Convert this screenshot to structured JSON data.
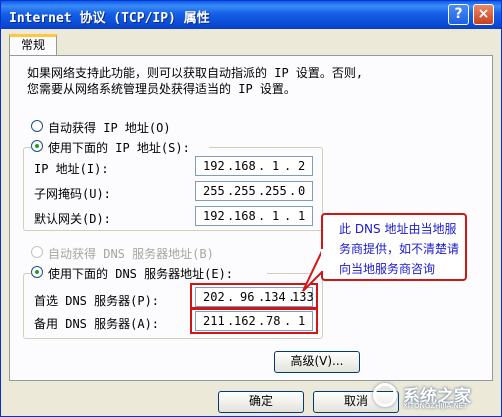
{
  "window": {
    "title": "Internet 协议 (TCP/IP) 属性",
    "help_glyph": "?",
    "close_glyph": "×"
  },
  "tab": {
    "label": "常规"
  },
  "description": {
    "line1": "如果网络支持此功能，则可以获取自动指派的 IP 设置。否则,",
    "line2": "您需要从网络系统管理员处获得适当的 IP 设置。"
  },
  "ip_section": {
    "auto_label": "自动获得 IP 地址(O)",
    "manual_label": "使用下面的 IP 地址(S):",
    "fields": [
      {
        "label": "IP 地址(I):",
        "octets": [
          "192",
          "168",
          "1",
          "2"
        ]
      },
      {
        "label": "子网掩码(U):",
        "octets": [
          "255",
          "255",
          "255",
          "0"
        ]
      },
      {
        "label": "默认网关(D):",
        "octets": [
          "192",
          "168",
          "1",
          "1"
        ]
      }
    ]
  },
  "dns_section": {
    "auto_label": "自动获得 DNS 服务器地址(B)",
    "manual_label": "使用下面的 DNS 服务器地址(E):",
    "fields": [
      {
        "label": "首选 DNS 服务器(P):",
        "octets": [
          "202",
          "96",
          "134",
          "133"
        ]
      },
      {
        "label": "备用 DNS 服务器(A):",
        "octets": [
          "211",
          "162",
          "78",
          "1"
        ]
      }
    ]
  },
  "callout": {
    "line1": "此 DNS 地址由当地服",
    "line2": "务商提供，如不清楚请",
    "line3": "向当地服务商咨询",
    "color": "#1a1ad0"
  },
  "buttons": {
    "advanced": "高级(V)...",
    "ok": "确定",
    "cancel": "取消"
  },
  "watermark": {
    "text": "系统之家",
    "sub": "XITONGZHIJIA.NET"
  },
  "colors": {
    "title_bar": "#0a5fe8",
    "highlight_red": "#d01515"
  }
}
